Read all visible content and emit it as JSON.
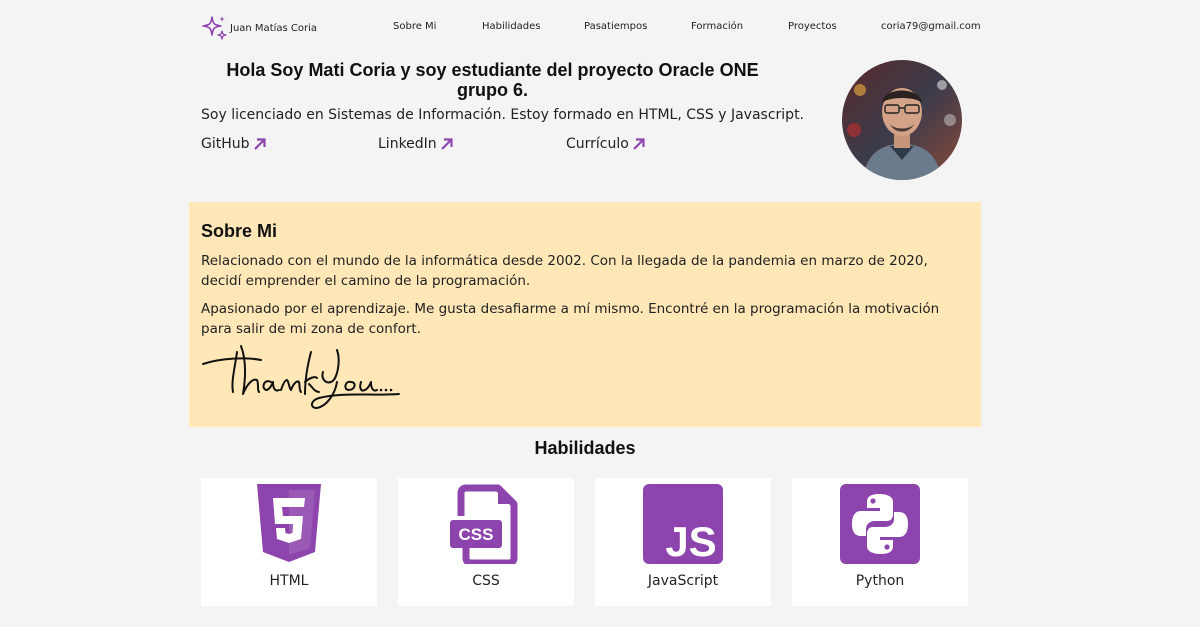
{
  "nav": {
    "brand": "Juan Matías Coria",
    "links": [
      "Sobre Mi",
      "Habilidades",
      "Pasatiempos",
      "Formación",
      "Proyectos"
    ],
    "email": "coria79@gmail.com"
  },
  "hero": {
    "title": "Hola Soy Mati Coria y soy estudiante del proyecto Oracle ONE grupo 6.",
    "description": "Soy licenciado en Sistemas de Información. Estoy formado en HTML, CSS y Javascript.",
    "links": [
      "GitHub",
      "LinkedIn",
      "Currículo"
    ]
  },
  "about": {
    "heading": "Sobre Mi",
    "paragraphs": [
      "Relacionado con el mundo de la informática desde 2002. Con la llegada de la pandemia en marzo de 2020, decidí emprender el camino de la programación.",
      "Apasionado por el aprendizaje. Me gusta desafiarme a mí mismo. Encontré en la programación la motivación para salir de mi zona de confort."
    ],
    "signature": "Thank You..."
  },
  "skills": {
    "heading": "Habilidades",
    "items": [
      {
        "label": "HTML",
        "icon": "html5-icon"
      },
      {
        "label": "CSS",
        "icon": "css-file-icon"
      },
      {
        "label": "JavaScript",
        "icon": "js-icon"
      },
      {
        "label": "Python",
        "icon": "python-icon"
      }
    ]
  },
  "colors": {
    "accent": "#8e44ad",
    "about_bg": "#ffe7b8",
    "page_bg": "#f4f4f4"
  }
}
